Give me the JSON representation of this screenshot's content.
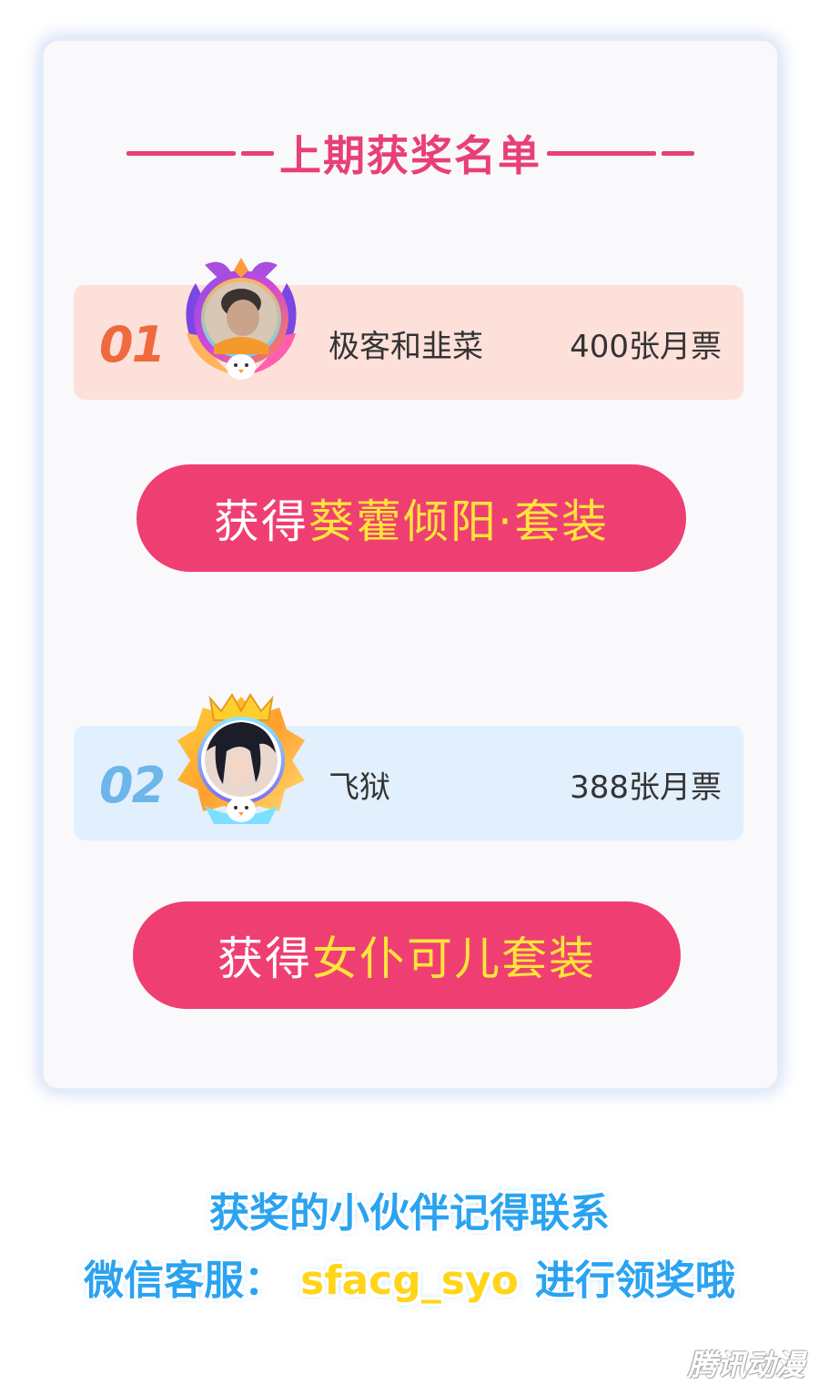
{
  "title": "上期获奖名单",
  "winners": [
    {
      "rank": "01",
      "name": "极客和韭菜",
      "votes": "400张月票",
      "prize_prefix": "获得",
      "prize_name": "葵藿倾阳·套装",
      "rank_color": "#ef6a3f",
      "row_color": "#fde0da"
    },
    {
      "rank": "02",
      "name": "飞狱",
      "votes": "388张月票",
      "prize_prefix": "获得",
      "prize_name": "女仆可儿套装",
      "rank_color": "#6cb6ea",
      "row_color": "#e2effd"
    }
  ],
  "footer": {
    "line1": "获奖的小伙伴记得联系",
    "line2_prefix": "微信客服：",
    "wechat_id": "sfacg_syo",
    "line2_suffix": "进行领奖哦"
  },
  "watermark": "腾讯动漫",
  "colors": {
    "accent": "#e83f76",
    "button": "#ef3f72",
    "prize_highlight": "#ffe53a",
    "footer_text": "#2aa3f0"
  }
}
